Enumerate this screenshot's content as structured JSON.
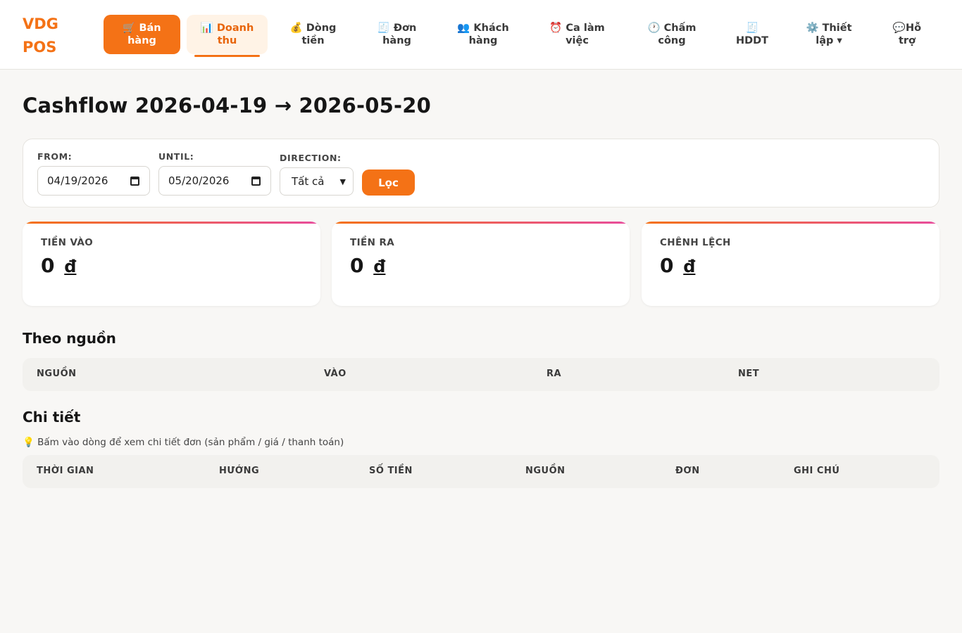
{
  "brand": {
    "logo_line1": "VDG",
    "logo_line2": "POS",
    "accent": "#f47216"
  },
  "nav": {
    "items": [
      {
        "icon": "🛒",
        "line1": "Bán",
        "line2": "hàng"
      },
      {
        "icon": "📊",
        "line1": "Doanh",
        "line2": "thu"
      },
      {
        "icon": "💰",
        "line1": "Dòng",
        "line2": "tiền"
      },
      {
        "icon": "🧾",
        "line1": "Đơn",
        "line2": "hàng"
      },
      {
        "icon": "👥",
        "line1": "Khách",
        "line2": "hàng"
      },
      {
        "icon": "⏰",
        "line1": "Ca làm",
        "line2": "việc"
      },
      {
        "icon": "🕐",
        "line1": "Chấm",
        "line2": "công"
      },
      {
        "icon": "🧾",
        "line1": "",
        "line2": "HDDT"
      },
      {
        "icon": "⚙️",
        "line1": "Thiết",
        "line2": "lập ▾"
      },
      {
        "icon": "💬",
        "line1": "Hỗ",
        "line2": "trợ"
      }
    ]
  },
  "page": {
    "title": "Cashflow 2026-04-19 → 2026-05-20"
  },
  "filter": {
    "from_label": "FROM:",
    "from_value": "04/19/2026",
    "until_label": "UNTIL:",
    "until_value": "05/20/2026",
    "direction_label": "DIRECTION:",
    "direction_value": "Tất cả",
    "button_label": "Lọc"
  },
  "stats": [
    {
      "label": "TIỀN VÀO",
      "amount": "0",
      "currency": "đ"
    },
    {
      "label": "TIỀN RA",
      "amount": "0",
      "currency": "đ"
    },
    {
      "label": "CHÊNH LỆCH",
      "amount": "0",
      "currency": "đ"
    }
  ],
  "by_source": {
    "title": "Theo nguồn",
    "columns": [
      "NGUỒN",
      "VÀO",
      "RA",
      "NET"
    ]
  },
  "detail": {
    "title": "Chi tiết",
    "hint_icon": "💡",
    "hint": "Bấm vào dòng để xem chi tiết đơn (sản phẩm / giá / thanh toán)",
    "columns": [
      "THỜI GIAN",
      "HƯỚNG",
      "SỐ TIỀN",
      "NGUỒN",
      "ĐƠN",
      "GHI CHÚ"
    ]
  }
}
